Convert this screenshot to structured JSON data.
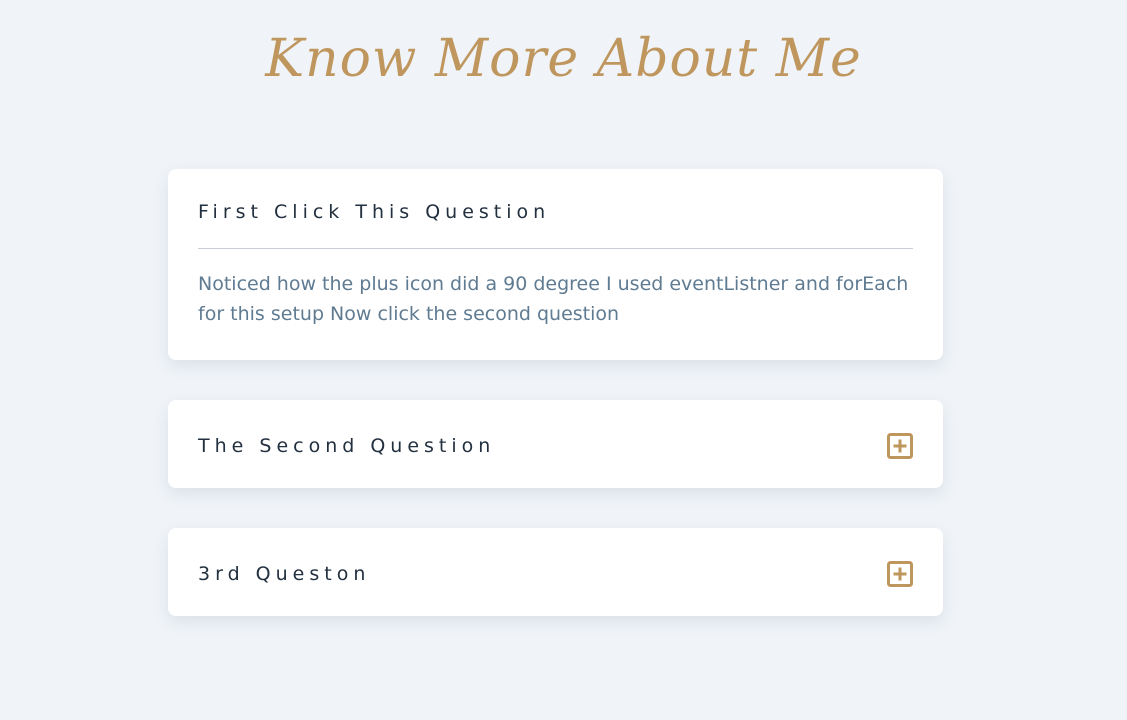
{
  "page": {
    "title": "Know More About Me"
  },
  "colors": {
    "background": "#f0f4f8",
    "accent": "#bf975e",
    "question_text": "#22303f",
    "answer_text": "#5f7b92",
    "card": "#ffffff"
  },
  "faq": {
    "items": [
      {
        "question": "First Click This Question",
        "answer": "Noticed how the plus icon did a 90 degree I used eventListner and forEach for this setup Now click the second question",
        "expanded": true
      },
      {
        "question": "The Second Question",
        "expanded": false,
        "icon": "plus-square-icon"
      },
      {
        "question": "3rd Queston",
        "expanded": false,
        "icon": "plus-square-icon"
      }
    ]
  }
}
